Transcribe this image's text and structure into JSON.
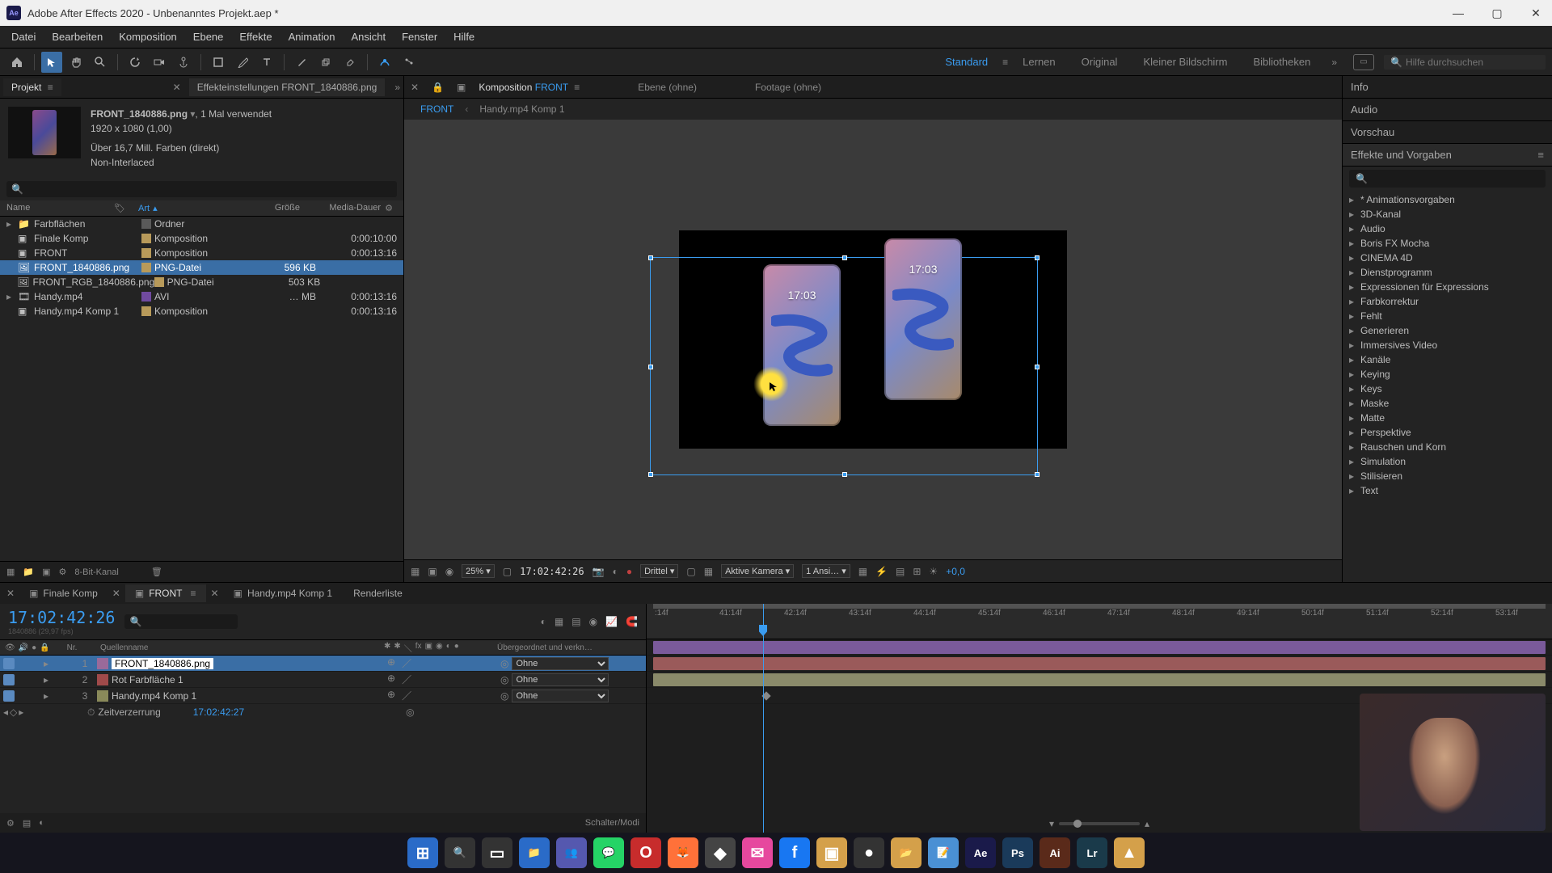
{
  "titlebar": {
    "app_icon_text": "Ae",
    "title": "Adobe After Effects 2020 - Unbenanntes Projekt.aep *"
  },
  "menu": [
    "Datei",
    "Bearbeiten",
    "Komposition",
    "Ebene",
    "Effekte",
    "Animation",
    "Ansicht",
    "Fenster",
    "Hilfe"
  ],
  "workspaces": {
    "items": [
      "Standard",
      "Lernen",
      "Original",
      "Kleiner Bildschirm",
      "Bibliotheken"
    ],
    "active": "Standard",
    "search_placeholder": "Hilfe durchsuchen"
  },
  "project_panel": {
    "tabs": {
      "project": "Projekt",
      "effect_controls": "Effekteinstellungen FRONT_1840886.png"
    },
    "asset": {
      "name": "FRONT_1840886.png",
      "usage": ", 1 Mal verwendet",
      "dims": "1920 x 1080 (1,00)",
      "colors": "Über 16,7 Mill. Farben (direkt)",
      "interlace": "Non-Interlaced"
    },
    "headers": {
      "name": "Name",
      "art": "Art",
      "size": "Größe",
      "dur": "Media-Dauer"
    },
    "items": [
      {
        "name": "Farbflächen",
        "art": "Ordner",
        "size": "",
        "dur": "",
        "color": "#5a5a5a",
        "twirl": "▸"
      },
      {
        "name": "Finale Komp",
        "art": "Komposition",
        "size": "",
        "dur": "0:00:10:00",
        "color": "#b89a5a",
        "twirl": ""
      },
      {
        "name": "FRONT",
        "art": "Komposition",
        "size": "",
        "dur": "0:00:13:16",
        "color": "#b89a5a",
        "twirl": ""
      },
      {
        "name": "FRONT_1840886.png",
        "art": "PNG-Datei",
        "size": "596 KB",
        "dur": "",
        "color": "#b89a5a",
        "twirl": "",
        "selected": true
      },
      {
        "name": "FRONT_RGB_1840886.png",
        "art": "PNG-Datei",
        "size": "503 KB",
        "dur": "",
        "color": "#b89a5a",
        "twirl": ""
      },
      {
        "name": "Handy.mp4",
        "art": "AVI",
        "size": "… MB",
        "dur": "0:00:13:16",
        "color": "#704aa0",
        "twirl": "▸"
      },
      {
        "name": "Handy.mp4 Komp 1",
        "art": "Komposition",
        "size": "",
        "dur": "0:00:13:16",
        "color": "#b89a5a",
        "twirl": ""
      }
    ],
    "bottom": {
      "depth": "8-Bit-Kanal"
    }
  },
  "comp_viewer": {
    "tabs": {
      "comp_prefix": "Komposition",
      "comp_name": "FRONT",
      "layer": "Ebene (ohne)",
      "footage": "Footage (ohne)"
    },
    "breadcrumb": [
      "FRONT",
      "Handy.mp4 Komp 1"
    ],
    "phone_time_left": "17:03",
    "phone_time_right": "17:03",
    "controls": {
      "zoom": "25%",
      "timecode": "17:02:42:26",
      "res": "Drittel",
      "camera": "Aktive Kamera",
      "views": "1 Ansi…",
      "exposure": "+0,0"
    }
  },
  "right": {
    "panels": [
      "Info",
      "Audio",
      "Vorschau",
      "Effekte und Vorgaben"
    ],
    "effects_categories": [
      "* Animationsvorgaben",
      "3D-Kanal",
      "Audio",
      "Boris FX Mocha",
      "CINEMA 4D",
      "Dienstprogramm",
      "Expressionen für Expressions",
      "Farbkorrektur",
      "Fehlt",
      "Generieren",
      "Immersives Video",
      "Kanäle",
      "Keying",
      "Keys",
      "Maske",
      "Matte",
      "Perspektive",
      "Rauschen und Korn",
      "Simulation",
      "Stilisieren",
      "Text"
    ]
  },
  "timeline": {
    "tabs": [
      "Finale Komp",
      "FRONT",
      "Handy.mp4 Komp 1",
      "Renderliste"
    ],
    "active_tab": "FRONT",
    "timecode": "17:02:42:26",
    "framerate_hint": "1840886 (29,97 fps)",
    "columns": {
      "num": "Nr.",
      "name": "Quellenname",
      "parent": "Übergeordnet und verkn…"
    },
    "layers": [
      {
        "num": "1",
        "name": "FRONT_1840886.png",
        "color": "#9a6a9a",
        "parent": "Ohne",
        "selected": true
      },
      {
        "num": "2",
        "name": "Rot Farbfläche 1",
        "color": "#a04a4a",
        "parent": "Ohne"
      },
      {
        "num": "3",
        "name": "Handy.mp4 Komp 1",
        "color": "#8a8a5a",
        "parent": "Ohne"
      }
    ],
    "prop": {
      "name": "Zeitverzerrung",
      "value": "17:02:42:27"
    },
    "ruler_ticks": [
      ":14f",
      "41:14f",
      "42:14f",
      "43:14f",
      "44:14f",
      "45:14f",
      "46:14f",
      "47:14f",
      "48:14f",
      "49:14f",
      "50:14f",
      "51:14f",
      "52:14f",
      "53:14f"
    ],
    "bottom_label": "Schalter/Modi"
  },
  "taskbar": {
    "icons": [
      {
        "name": "windows",
        "glyph": "⊞",
        "bg": "#2a6bc8"
      },
      {
        "name": "search",
        "glyph": "🔍",
        "bg": "#333"
      },
      {
        "name": "taskview",
        "glyph": "▭",
        "bg": "#333"
      },
      {
        "name": "explorer",
        "glyph": "📁",
        "bg": "#2a6bc8"
      },
      {
        "name": "teams",
        "glyph": "👥",
        "bg": "#5558af"
      },
      {
        "name": "whatsapp",
        "glyph": "💬",
        "bg": "#25d366"
      },
      {
        "name": "opera",
        "glyph": "O",
        "bg": "#c72c2c"
      },
      {
        "name": "firefox",
        "glyph": "🦊",
        "bg": "#ff7139"
      },
      {
        "name": "app1",
        "glyph": "◆",
        "bg": "#444"
      },
      {
        "name": "messenger",
        "glyph": "✉",
        "bg": "#e6489e"
      },
      {
        "name": "facebook",
        "glyph": "f",
        "bg": "#1877f2"
      },
      {
        "name": "app2",
        "glyph": "▣",
        "bg": "#d4a04a"
      },
      {
        "name": "obs",
        "glyph": "●",
        "bg": "#333"
      },
      {
        "name": "folder",
        "glyph": "📂",
        "bg": "#d4a04a"
      },
      {
        "name": "notepad",
        "glyph": "📝",
        "bg": "#4a90d4"
      },
      {
        "name": "aftereffects",
        "glyph": "Ae",
        "bg": "#1a1a4a"
      },
      {
        "name": "photoshop",
        "glyph": "Ps",
        "bg": "#1a3a5a"
      },
      {
        "name": "illustrator",
        "glyph": "Ai",
        "bg": "#5a2a1a"
      },
      {
        "name": "lightroom",
        "glyph": "Lr",
        "bg": "#1a3a4a"
      },
      {
        "name": "app3",
        "glyph": "▲",
        "bg": "#d4a04a"
      }
    ]
  }
}
